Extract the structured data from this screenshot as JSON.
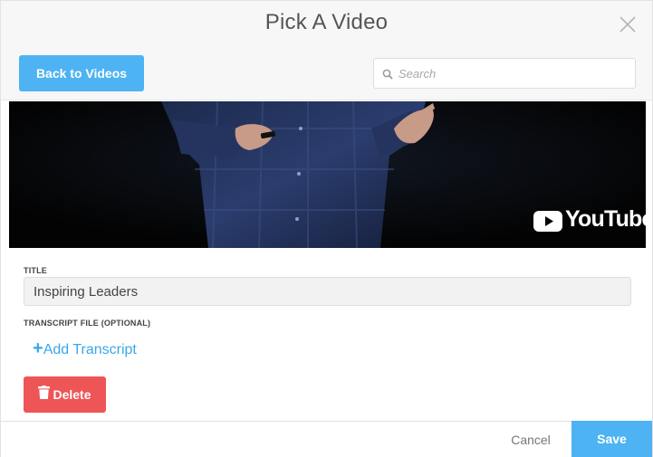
{
  "modal": {
    "title": "Pick A Video"
  },
  "toolbar": {
    "back_label": "Back to Videos",
    "search_placeholder": "Search",
    "search_value": ""
  },
  "video": {
    "provider_label": "YouTube"
  },
  "form": {
    "title_label": "TITLE",
    "title_value": "Inspiring Leaders",
    "transcript_label": "TRANSCRIPT FILE (OPTIONAL)",
    "add_transcript_plus": "+",
    "add_transcript_label": "Add Transcript",
    "delete_label": "Delete"
  },
  "footer": {
    "cancel_label": "Cancel",
    "save_label": "Save"
  },
  "icons": {
    "close": "close-icon",
    "search": "search-icon",
    "trash": "trash-icon",
    "youtube": "youtube-logo-icon"
  },
  "colors": {
    "accent": "#4db3f3",
    "link": "#3aa8e8",
    "danger": "#ee5557"
  }
}
